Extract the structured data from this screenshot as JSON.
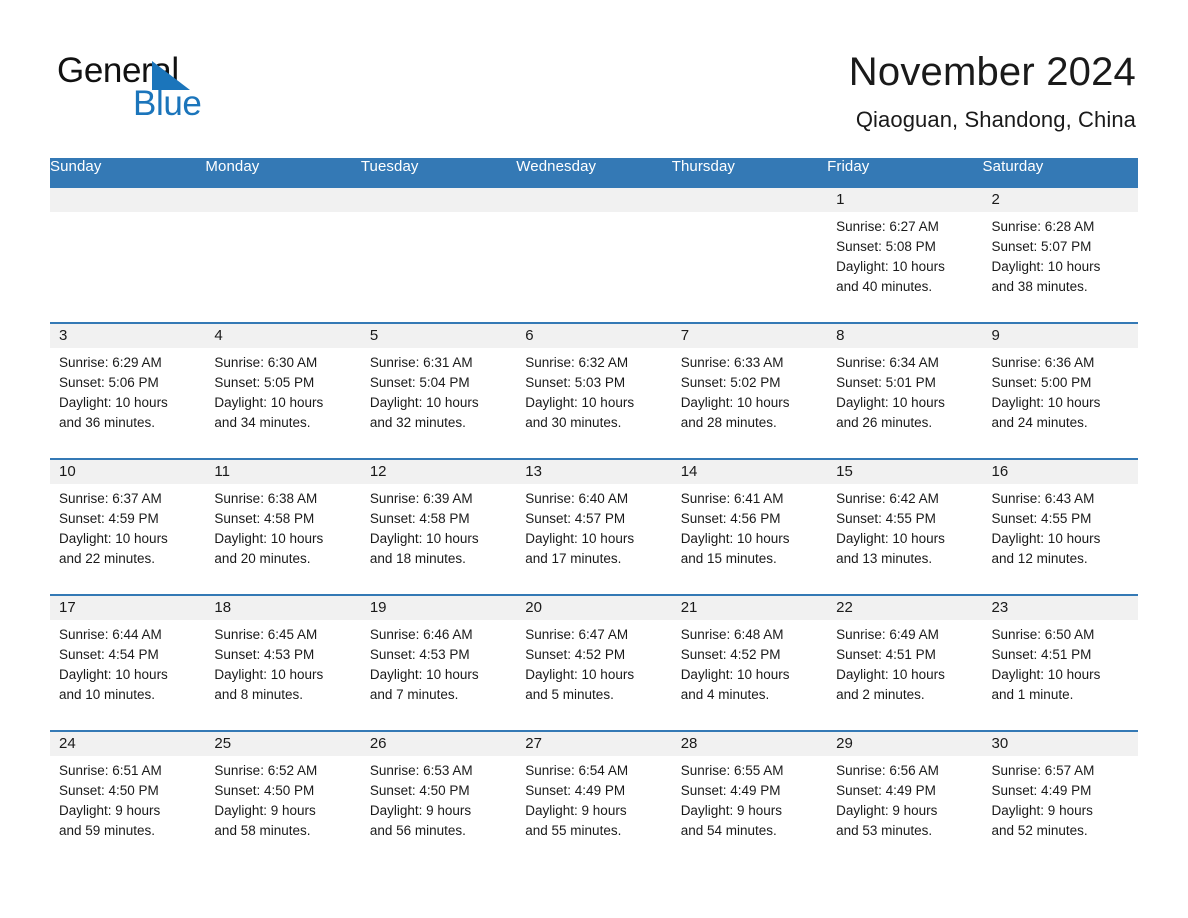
{
  "brand": {
    "name_part1": "General",
    "name_part2": "Blue",
    "accent_color": "#1b75bb"
  },
  "header": {
    "title": "November 2024",
    "subtitle": "Qiaoguan, Shandong, China"
  },
  "theme": {
    "header_bar": "#3479b5",
    "daynum_band": "#f1f1f1",
    "week_rule": "#3479b5",
    "text": "#1a1a1a"
  },
  "weekdays": [
    "Sunday",
    "Monday",
    "Tuesday",
    "Wednesday",
    "Thursday",
    "Friday",
    "Saturday"
  ],
  "weeks": [
    [
      {
        "day": "",
        "empty": true
      },
      {
        "day": "",
        "empty": true
      },
      {
        "day": "",
        "empty": true
      },
      {
        "day": "",
        "empty": true
      },
      {
        "day": "",
        "empty": true
      },
      {
        "day": "1",
        "sunrise": "Sunrise: 6:27 AM",
        "sunset": "Sunset: 5:08 PM",
        "daylight1": "Daylight: 10 hours",
        "daylight2": "and 40 minutes."
      },
      {
        "day": "2",
        "sunrise": "Sunrise: 6:28 AM",
        "sunset": "Sunset: 5:07 PM",
        "daylight1": "Daylight: 10 hours",
        "daylight2": "and 38 minutes."
      }
    ],
    [
      {
        "day": "3",
        "sunrise": "Sunrise: 6:29 AM",
        "sunset": "Sunset: 5:06 PM",
        "daylight1": "Daylight: 10 hours",
        "daylight2": "and 36 minutes."
      },
      {
        "day": "4",
        "sunrise": "Sunrise: 6:30 AM",
        "sunset": "Sunset: 5:05 PM",
        "daylight1": "Daylight: 10 hours",
        "daylight2": "and 34 minutes."
      },
      {
        "day": "5",
        "sunrise": "Sunrise: 6:31 AM",
        "sunset": "Sunset: 5:04 PM",
        "daylight1": "Daylight: 10 hours",
        "daylight2": "and 32 minutes."
      },
      {
        "day": "6",
        "sunrise": "Sunrise: 6:32 AM",
        "sunset": "Sunset: 5:03 PM",
        "daylight1": "Daylight: 10 hours",
        "daylight2": "and 30 minutes."
      },
      {
        "day": "7",
        "sunrise": "Sunrise: 6:33 AM",
        "sunset": "Sunset: 5:02 PM",
        "daylight1": "Daylight: 10 hours",
        "daylight2": "and 28 minutes."
      },
      {
        "day": "8",
        "sunrise": "Sunrise: 6:34 AM",
        "sunset": "Sunset: 5:01 PM",
        "daylight1": "Daylight: 10 hours",
        "daylight2": "and 26 minutes."
      },
      {
        "day": "9",
        "sunrise": "Sunrise: 6:36 AM",
        "sunset": "Sunset: 5:00 PM",
        "daylight1": "Daylight: 10 hours",
        "daylight2": "and 24 minutes."
      }
    ],
    [
      {
        "day": "10",
        "sunrise": "Sunrise: 6:37 AM",
        "sunset": "Sunset: 4:59 PM",
        "daylight1": "Daylight: 10 hours",
        "daylight2": "and 22 minutes."
      },
      {
        "day": "11",
        "sunrise": "Sunrise: 6:38 AM",
        "sunset": "Sunset: 4:58 PM",
        "daylight1": "Daylight: 10 hours",
        "daylight2": "and 20 minutes."
      },
      {
        "day": "12",
        "sunrise": "Sunrise: 6:39 AM",
        "sunset": "Sunset: 4:58 PM",
        "daylight1": "Daylight: 10 hours",
        "daylight2": "and 18 minutes."
      },
      {
        "day": "13",
        "sunrise": "Sunrise: 6:40 AM",
        "sunset": "Sunset: 4:57 PM",
        "daylight1": "Daylight: 10 hours",
        "daylight2": "and 17 minutes."
      },
      {
        "day": "14",
        "sunrise": "Sunrise: 6:41 AM",
        "sunset": "Sunset: 4:56 PM",
        "daylight1": "Daylight: 10 hours",
        "daylight2": "and 15 minutes."
      },
      {
        "day": "15",
        "sunrise": "Sunrise: 6:42 AM",
        "sunset": "Sunset: 4:55 PM",
        "daylight1": "Daylight: 10 hours",
        "daylight2": "and 13 minutes."
      },
      {
        "day": "16",
        "sunrise": "Sunrise: 6:43 AM",
        "sunset": "Sunset: 4:55 PM",
        "daylight1": "Daylight: 10 hours",
        "daylight2": "and 12 minutes."
      }
    ],
    [
      {
        "day": "17",
        "sunrise": "Sunrise: 6:44 AM",
        "sunset": "Sunset: 4:54 PM",
        "daylight1": "Daylight: 10 hours",
        "daylight2": "and 10 minutes."
      },
      {
        "day": "18",
        "sunrise": "Sunrise: 6:45 AM",
        "sunset": "Sunset: 4:53 PM",
        "daylight1": "Daylight: 10 hours",
        "daylight2": "and 8 minutes."
      },
      {
        "day": "19",
        "sunrise": "Sunrise: 6:46 AM",
        "sunset": "Sunset: 4:53 PM",
        "daylight1": "Daylight: 10 hours",
        "daylight2": "and 7 minutes."
      },
      {
        "day": "20",
        "sunrise": "Sunrise: 6:47 AM",
        "sunset": "Sunset: 4:52 PM",
        "daylight1": "Daylight: 10 hours",
        "daylight2": "and 5 minutes."
      },
      {
        "day": "21",
        "sunrise": "Sunrise: 6:48 AM",
        "sunset": "Sunset: 4:52 PM",
        "daylight1": "Daylight: 10 hours",
        "daylight2": "and 4 minutes."
      },
      {
        "day": "22",
        "sunrise": "Sunrise: 6:49 AM",
        "sunset": "Sunset: 4:51 PM",
        "daylight1": "Daylight: 10 hours",
        "daylight2": "and 2 minutes."
      },
      {
        "day": "23",
        "sunrise": "Sunrise: 6:50 AM",
        "sunset": "Sunset: 4:51 PM",
        "daylight1": "Daylight: 10 hours",
        "daylight2": "and 1 minute."
      }
    ],
    [
      {
        "day": "24",
        "sunrise": "Sunrise: 6:51 AM",
        "sunset": "Sunset: 4:50 PM",
        "daylight1": "Daylight: 9 hours",
        "daylight2": "and 59 minutes."
      },
      {
        "day": "25",
        "sunrise": "Sunrise: 6:52 AM",
        "sunset": "Sunset: 4:50 PM",
        "daylight1": "Daylight: 9 hours",
        "daylight2": "and 58 minutes."
      },
      {
        "day": "26",
        "sunrise": "Sunrise: 6:53 AM",
        "sunset": "Sunset: 4:50 PM",
        "daylight1": "Daylight: 9 hours",
        "daylight2": "and 56 minutes."
      },
      {
        "day": "27",
        "sunrise": "Sunrise: 6:54 AM",
        "sunset": "Sunset: 4:49 PM",
        "daylight1": "Daylight: 9 hours",
        "daylight2": "and 55 minutes."
      },
      {
        "day": "28",
        "sunrise": "Sunrise: 6:55 AM",
        "sunset": "Sunset: 4:49 PM",
        "daylight1": "Daylight: 9 hours",
        "daylight2": "and 54 minutes."
      },
      {
        "day": "29",
        "sunrise": "Sunrise: 6:56 AM",
        "sunset": "Sunset: 4:49 PM",
        "daylight1": "Daylight: 9 hours",
        "daylight2": "and 53 minutes."
      },
      {
        "day": "30",
        "sunrise": "Sunrise: 6:57 AM",
        "sunset": "Sunset: 4:49 PM",
        "daylight1": "Daylight: 9 hours",
        "daylight2": "and 52 minutes."
      }
    ]
  ]
}
